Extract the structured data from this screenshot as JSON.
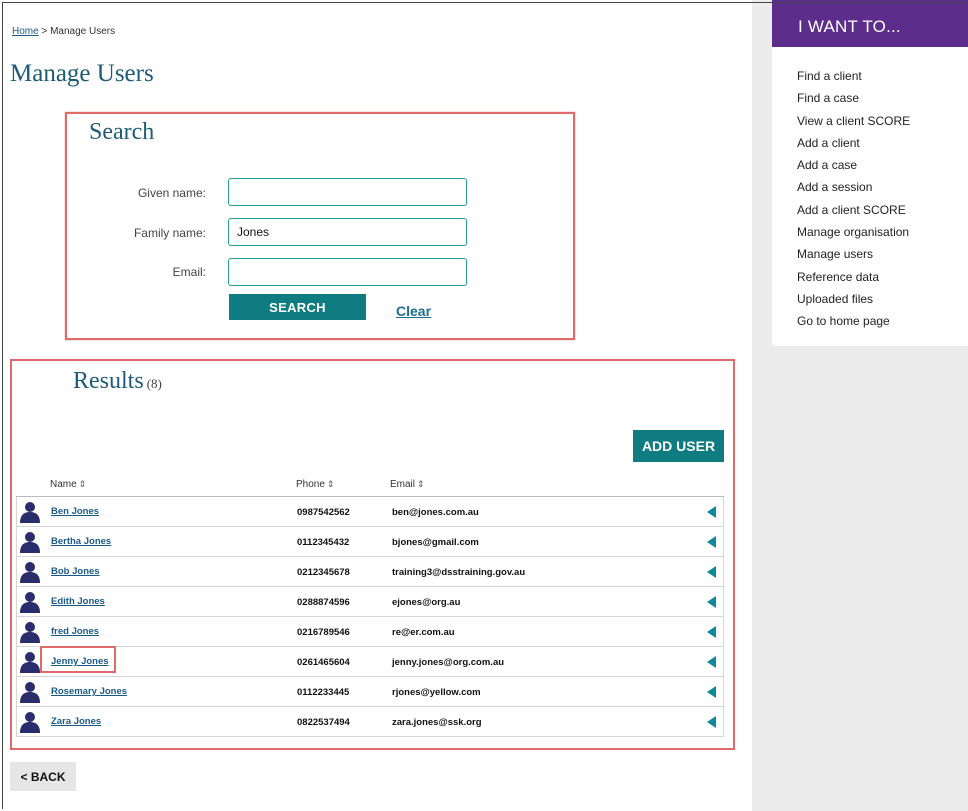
{
  "breadcrumb": {
    "home": "Home",
    "separator": ">",
    "current": "Manage Users"
  },
  "page": {
    "title": "Manage Users"
  },
  "search": {
    "title": "Search",
    "given_label": "Given name:",
    "given_value": "",
    "family_label": "Family name:",
    "family_value": "Jones",
    "email_label": "Email:",
    "email_value": "",
    "search_label": "SEARCH",
    "clear_label": "Clear"
  },
  "results": {
    "title": "Results",
    "count": "(8)",
    "add_user_label": "ADD USER",
    "columns": {
      "name": "Name",
      "phone": "Phone",
      "email": "Email"
    },
    "rows": [
      {
        "name": "Ben Jones",
        "phone": "0987542562",
        "email": "ben@jones.com.au"
      },
      {
        "name": "Bertha Jones",
        "phone": "0112345432",
        "email": "bjones@gmail.com"
      },
      {
        "name": "Bob Jones",
        "phone": "0212345678",
        "email": "training3@dsstraining.gov.au"
      },
      {
        "name": "Edith Jones",
        "phone": "0288874596",
        "email": "ejones@org.au"
      },
      {
        "name": "fred Jones",
        "phone": "0216789546",
        "email": "re@er.com.au"
      },
      {
        "name": "Jenny Jones",
        "phone": "0261465604",
        "email": "jenny.jones@org.com.au"
      },
      {
        "name": "Rosemary Jones",
        "phone": "0112233445",
        "email": "rjones@yellow.com"
      },
      {
        "name": "Zara Jones",
        "phone": "0822537494",
        "email": "zara.jones@ssk.org"
      }
    ]
  },
  "back": {
    "label": "< BACK"
  },
  "sidebar": {
    "title": "I WANT TO...",
    "items": [
      "Find a client",
      "Find a case",
      "View a client SCORE",
      "Add a client",
      "Add a case",
      "Add a session",
      "Add a client SCORE",
      "Manage organisation",
      "Manage users",
      "Reference data",
      "Uploaded files",
      "Go to home page"
    ]
  },
  "icons": {
    "avatar": "person-silhouette-icon",
    "sort": "sort-updown-icon",
    "row_action": "triangle-left-icon"
  },
  "colors": {
    "header_purple": "#5d2d8b",
    "button_teal": "#0e7c80",
    "title_blue": "#1d5b78",
    "highlight_red": "#e06a6a",
    "avatar_navy": "#2a2d6b",
    "arrow_teal": "#0d8a9a"
  }
}
